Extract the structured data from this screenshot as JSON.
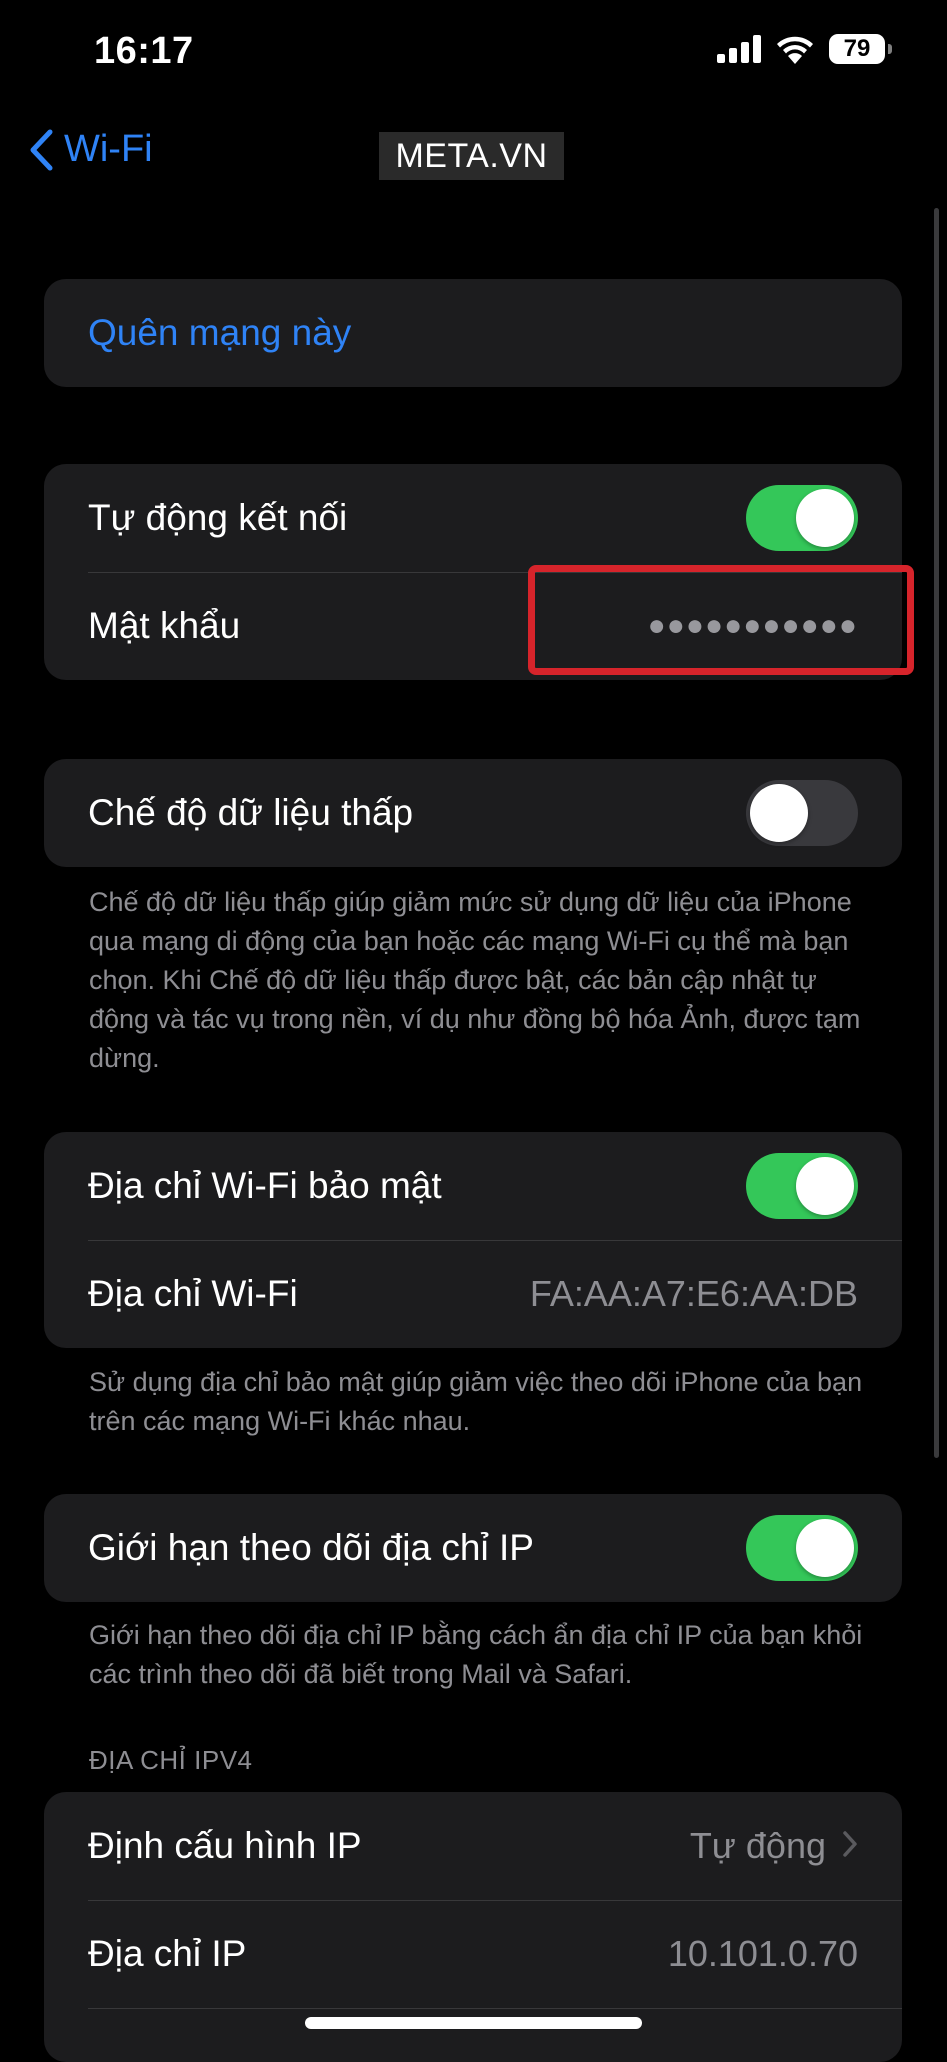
{
  "status_bar": {
    "time": "16:17",
    "battery_level": "79"
  },
  "nav": {
    "back_label": "Wi-Fi",
    "watermark": "META.VN"
  },
  "forget_group": {
    "forget_label": "Quên mạng này"
  },
  "connection_group": {
    "auto_join_label": "Tự động kết nối",
    "auto_join_on": true,
    "password_label": "Mật khẩu",
    "password_value": "●●●●●●●●●●●"
  },
  "low_data_group": {
    "low_data_label": "Chế độ dữ liệu thấp",
    "low_data_on": false,
    "low_data_footnote": "Chế độ dữ liệu thấp giúp giảm mức sử dụng dữ liệu của iPhone qua mạng di động của bạn hoặc các mạng Wi-Fi cụ thể mà bạn chọn. Khi Chế độ dữ liệu thấp được bật, các bản cập nhật tự động và tác vụ trong nền, ví dụ như đồng bộ hóa Ảnh, được tạm dừng."
  },
  "private_address_group": {
    "private_address_label": "Địa chỉ Wi-Fi bảo mật",
    "private_address_on": true,
    "wifi_address_label": "Địa chỉ Wi-Fi",
    "wifi_address_value": "FA:AA:A7:E6:AA:DB",
    "private_address_footnote": "Sử dụng địa chỉ bảo mật giúp giảm việc theo dõi iPhone của bạn trên các mạng Wi-Fi khác nhau."
  },
  "ip_tracking_group": {
    "limit_tracking_label": "Giới hạn theo dõi địa chỉ IP",
    "limit_tracking_on": true,
    "limit_tracking_footnote": "Giới hạn theo dõi địa chỉ IP bằng cách ẩn địa chỉ IP của bạn khỏi các trình theo dõi đã biết trong Mail và Safari."
  },
  "ipv4_group": {
    "section_header": "ĐỊA CHỈ IPV4",
    "configure_ip_label": "Định cấu hình IP",
    "configure_ip_value": "Tự động",
    "ip_address_label": "Địa chỉ IP",
    "ip_address_value": "10.101.0.70"
  },
  "colors": {
    "accent_blue": "#2f83f6",
    "toggle_on_green": "#34c759",
    "highlight_red": "#d6242b",
    "group_background": "#1c1c1e"
  }
}
